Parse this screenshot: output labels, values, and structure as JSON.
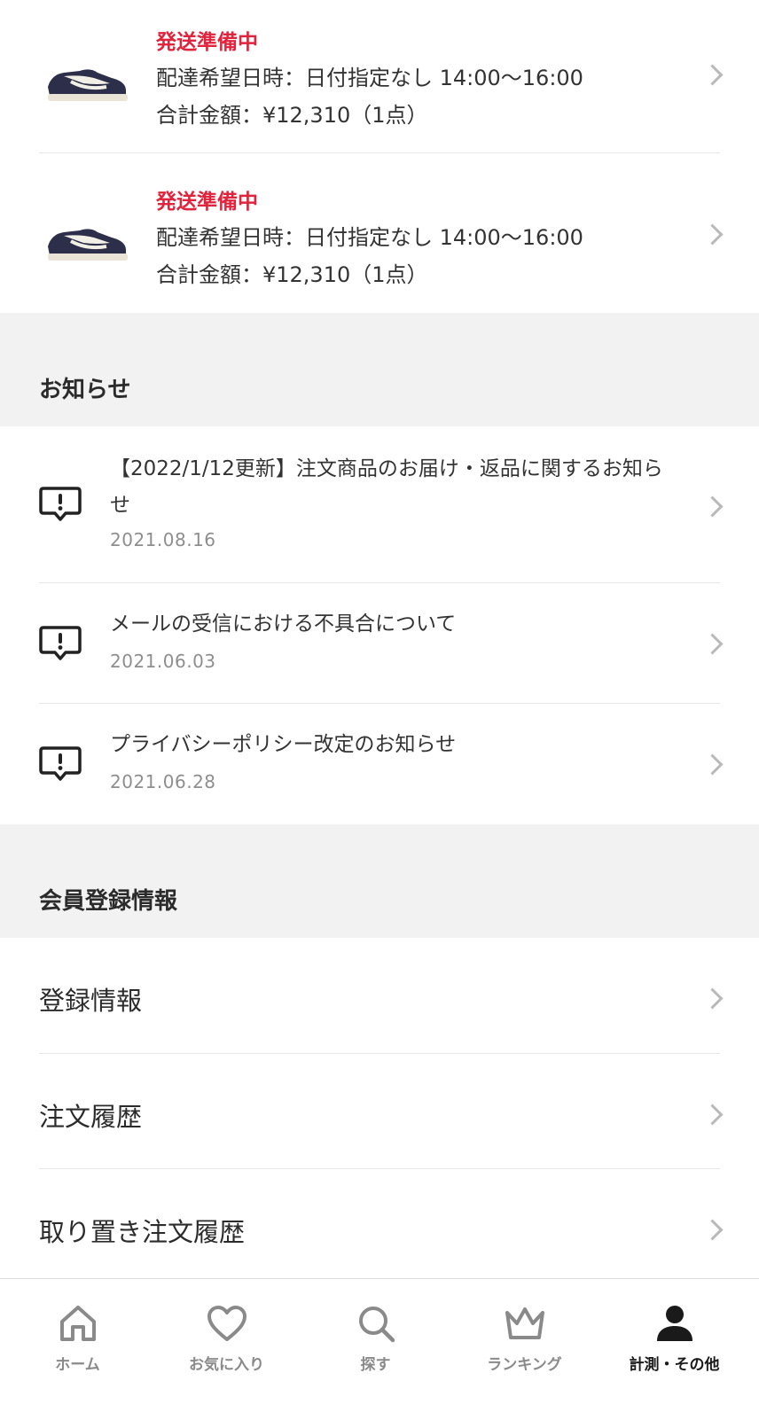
{
  "orders": [
    {
      "status": "発送準備中",
      "delivery": "配達希望日時：日付指定なし 14:00〜16:00",
      "total": "合計金額：¥12,310（1点）"
    },
    {
      "status": "発送準備中",
      "delivery": "配達希望日時：日付指定なし 14:00〜16:00",
      "total": "合計金額：¥12,310（1点）"
    }
  ],
  "news": {
    "heading": "お知らせ",
    "items": [
      {
        "title": "【2022/1/12更新】注文商品のお届け・返品に関するお知らせ",
        "date": "2021.08.16"
      },
      {
        "title": "メールの受信における不具合について",
        "date": "2021.06.03"
      },
      {
        "title": "プライバシーポリシー改定のお知らせ",
        "date": "2021.06.28"
      }
    ]
  },
  "member": {
    "heading": "会員登録情報",
    "items": [
      "登録情報",
      "注文履歴",
      "取り置き注文履歴"
    ]
  },
  "tabbar": {
    "tabs": [
      "ホーム",
      "お気に入り",
      "探す",
      "ランキング",
      "計測・その他"
    ],
    "active_index": 4
  },
  "colors": {
    "status_red": "#e0243d",
    "section_bg": "#f2f2f2"
  }
}
